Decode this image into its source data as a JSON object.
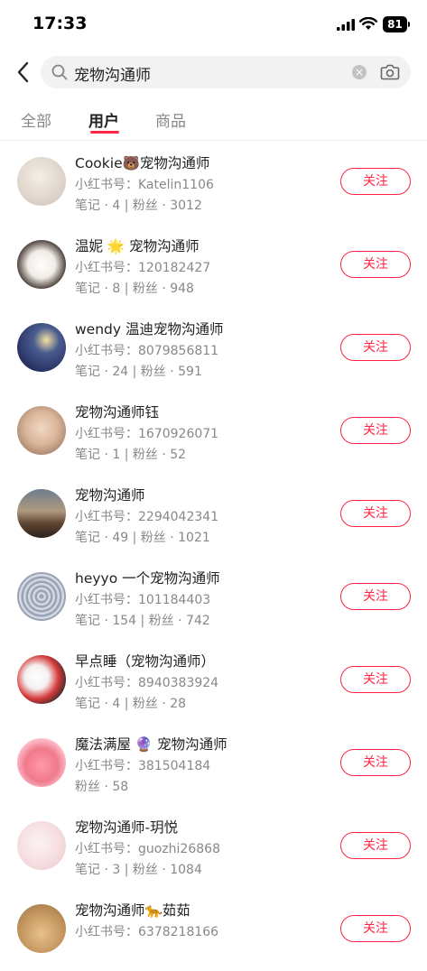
{
  "status": {
    "time": "17:33",
    "battery": "81"
  },
  "search": {
    "query": "宠物沟通师"
  },
  "tabs": [
    "全部",
    "用户",
    "商品"
  ],
  "users": [
    {
      "name": "Cookie🐻宠物沟通师",
      "redbook": "小红书号：Katelin1106",
      "stats": "笔记 · 4 | 粉丝 · 3012",
      "follow": "关注"
    },
    {
      "name": "温妮 🌟 宠物沟通师",
      "redbook": "小红书号：120182427",
      "stats": "笔记 · 8 | 粉丝 · 948",
      "follow": "关注"
    },
    {
      "name": "wendy 温迪宠物沟通师",
      "redbook": "小红书号：8079856811",
      "stats": "笔记 · 24 | 粉丝 · 591",
      "follow": "关注"
    },
    {
      "name": "宠物沟通师钰",
      "redbook": "小红书号：1670926071",
      "stats": "笔记 · 1 | 粉丝 · 52",
      "follow": "关注"
    },
    {
      "name": "宠物沟通师",
      "redbook": "小红书号：2294042341",
      "stats": "笔记 · 49 | 粉丝 · 1021",
      "follow": "关注"
    },
    {
      "name": "heyyo 一个宠物沟通师",
      "redbook": "小红书号：101184403",
      "stats": "笔记 · 154 | 粉丝 · 742",
      "follow": "关注"
    },
    {
      "name": "早点睡（宠物沟通师）",
      "redbook": "小红书号：8940383924",
      "stats": "笔记 · 4 | 粉丝 · 28",
      "follow": "关注"
    },
    {
      "name": "魔法满屋 🔮 宠物沟通师",
      "redbook": "小红书号：381504184",
      "stats": "粉丝 · 58",
      "follow": "关注"
    },
    {
      "name": "宠物沟通师-玥悦",
      "redbook": "小红书号：guozhi26868",
      "stats": "笔记 · 3 | 粉丝 · 1084",
      "follow": "关注"
    },
    {
      "name": "宠物沟通师🐆茹茹",
      "redbook": "小红书号：6378218166",
      "stats": "",
      "follow": "关注"
    }
  ],
  "colors": {
    "accent": "#ff2442",
    "muted": "#888888"
  }
}
